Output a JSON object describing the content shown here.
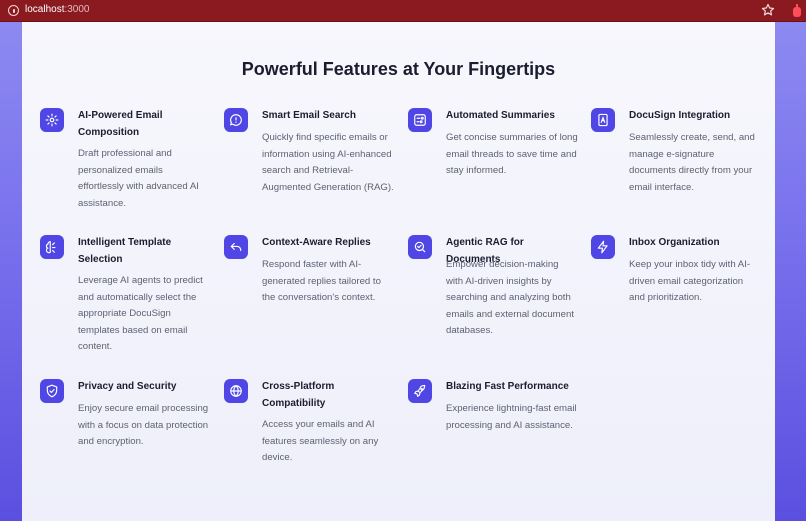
{
  "browser": {
    "url_host": "localhost",
    "url_port": ":3000"
  },
  "section": {
    "title": "Powerful Features at Your Fingertips"
  },
  "features": [
    {
      "title": "AI-Powered Email Composition",
      "description": "Draft professional and personalized emails effortlessly with advanced AI assistance.",
      "icon": "sparkle-gear-icon"
    },
    {
      "title": "Smart Email Search",
      "description": "Quickly find specific emails or information using AI-enhanced search and Retrieval-Augmented Generation (RAG).",
      "icon": "chat-bubble-icon"
    },
    {
      "title": "Automated Summaries",
      "description": "Get concise summaries of long email threads to save time and stay informed.",
      "icon": "summary-icon"
    },
    {
      "title": "DocuSign Integration",
      "description": "Seamlessly create, send, and manage e-signature documents directly from your email interface.",
      "icon": "document-signature-icon"
    },
    {
      "title": "Intelligent Template Selection",
      "description": "Leverage AI agents to predict and automatically select the appropriate DocuSign templates based on email content.",
      "icon": "brain-icon"
    },
    {
      "title": "Context-Aware Replies",
      "description": "Respond faster with AI-generated replies tailored to the conversation's context.",
      "icon": "reply-arrow-icon"
    },
    {
      "title": "Agentic RAG for Documents",
      "description": "Empower decision-making with AI-driven insights by searching and analyzing both emails and external document databases.",
      "icon": "search-check-icon"
    },
    {
      "title": "Inbox Organization",
      "description": "Keep your inbox tidy with AI-driven email categorization and prioritization.",
      "icon": "lightning-icon"
    },
    {
      "title": "Privacy and Security",
      "description": "Enjoy secure email processing with a focus on data protection and encryption.",
      "icon": "shield-check-icon"
    },
    {
      "title": "Cross-Platform Compatibility",
      "description": "Access your emails and AI features seamlessly on any device.",
      "icon": "globe-icon"
    },
    {
      "title": "Blazing Fast Performance",
      "description": "Experience lightning-fast email processing and AI assistance.",
      "icon": "rocket-icon"
    }
  ],
  "colors": {
    "accent": "#5046e5",
    "browser_bar": "#8a1a1f",
    "heading": "#1b1d2e",
    "body_text": "#5d6172"
  }
}
